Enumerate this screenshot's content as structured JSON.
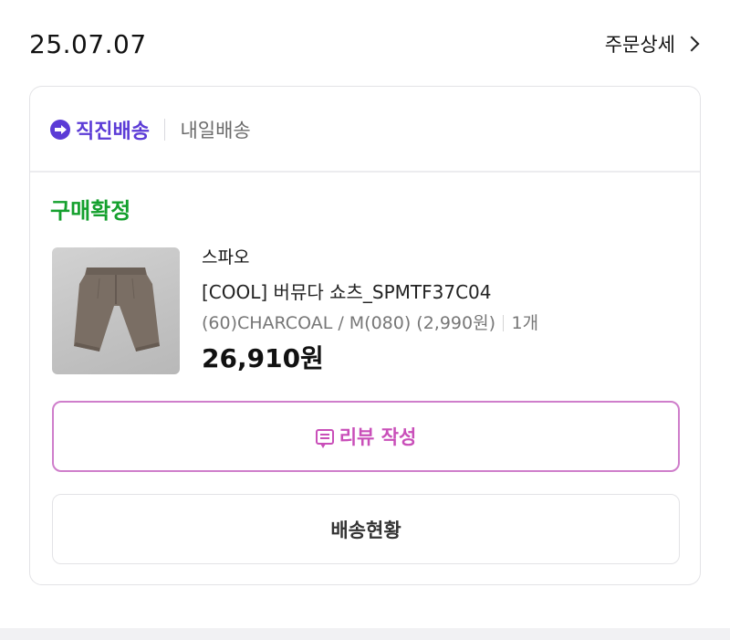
{
  "order": {
    "date": "25.07.07",
    "detail_link_label": "주문상세"
  },
  "delivery": {
    "direct_label": "직진배송",
    "tomorrow_label": "내일배송"
  },
  "status": {
    "label": "구매확정",
    "color": "#14a02d"
  },
  "product": {
    "brand": "스파오",
    "name": "[COOL] 버뮤다 쇼츠_SPMTF37C04",
    "option": "(60)CHARCOAL / M(080)  (2,990원)",
    "quantity": "1개",
    "price": "26,910원"
  },
  "buttons": {
    "review_label": "리뷰 작성",
    "tracking_label": "배송현황"
  },
  "colors": {
    "accent_purple": "#5b3bd6",
    "review_pink": "#c94fb9",
    "status_green": "#14a02d"
  }
}
